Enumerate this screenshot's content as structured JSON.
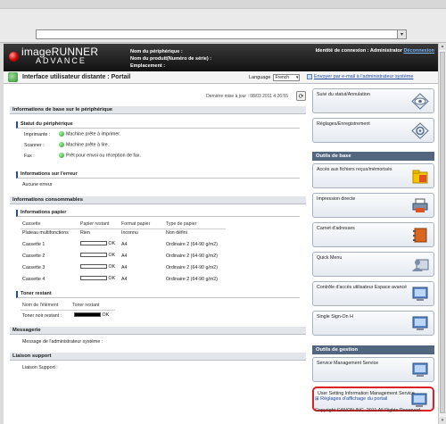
{
  "browser": {
    "address": ""
  },
  "header": {
    "logo_main": "imageRUNNER",
    "logo_sub": "ADVANCE",
    "device_name_label": "Nom du périphérique :",
    "product_name_label": "Nom du produit(Numéro de série) :",
    "location_label": "Emplacement :",
    "login_text": "Identité de connexion : Administrator",
    "logout_link": "Déconnexion"
  },
  "titlebar": {
    "title": "Interface utilisateur distante : Portail",
    "language_label": "Language",
    "language_value": "French",
    "email_link": "Envoyer par e-mail à l'administrateur système"
  },
  "main": {
    "last_update": "Dernière mise à jour : 08/03 2011 4:26:55",
    "basic_info_header": "Informations de base sur le périphérique",
    "device_status_header": "Statut du périphérique",
    "status_rows": [
      {
        "label": "Imprimante :",
        "value": "Machine prête à imprimer."
      },
      {
        "label": "Scanner :",
        "value": "Machine prête à lire."
      },
      {
        "label": "Fax :",
        "value": "Prêt pour envoi ou réception de fax."
      }
    ],
    "error_header": "Informations sur l'erreur",
    "error_value": "Aucune erreur",
    "consumables_header": "Informations consommables",
    "paper_header": "Informations papier",
    "paper_columns": [
      "Cassette",
      "Papier restant",
      "Format papier",
      "Type de papier"
    ],
    "paper_rows": [
      {
        "name": "Plateau multifonctions",
        "remaining": "Rien",
        "format": "Inconnu",
        "type": "Non défini"
      },
      {
        "name": "Cassette 1",
        "remaining": "OK",
        "format": "A4",
        "type": "Ordinaire 2 (64-90 g/m2)"
      },
      {
        "name": "Cassette 2",
        "remaining": "OK",
        "format": "A4",
        "type": "Ordinaire 2 (64-90 g/m2)"
      },
      {
        "name": "Cassette 3",
        "remaining": "OK",
        "format": "A4",
        "type": "Ordinaire 2 (64-90 g/m2)"
      },
      {
        "name": "Cassette 4",
        "remaining": "OK",
        "format": "A4",
        "type": "Ordinaire 2 (64-90 g/m2)"
      }
    ],
    "toner_header": "Toner restant",
    "toner_columns": [
      "Nom de l'élément",
      "Toner restant"
    ],
    "toner_label": "Toner noir restant :",
    "toner_value": "OK",
    "messages_header": "Messagerie",
    "admin_message_label": "Message de l'administrateur système :",
    "support_header": "Liaison support",
    "support_label": "Liaison Support :"
  },
  "right_panel": {
    "cards_top": [
      {
        "label": "Suivi du statut/Annulation",
        "icon": "eye-icon"
      },
      {
        "label": "Réglages/Enregistrement",
        "icon": "gear-icon"
      }
    ],
    "tools_header": "Outils de base",
    "tools": [
      {
        "label": "Accès aux fichiers reçus/mémorisés",
        "icon": "folder-icon"
      },
      {
        "label": "Impression directe",
        "icon": "printer-icon"
      },
      {
        "label": "Carnet d'adresses",
        "icon": "address-book-icon"
      },
      {
        "label": "Quick Menu",
        "icon": "user-menu-icon"
      },
      {
        "label": "Contrôle d'accès utilisateur Espace avancé",
        "icon": "monitor-icon"
      },
      {
        "label": "Single Sign-On H",
        "icon": "monitor-icon"
      }
    ],
    "management_header": "Outils de gestion",
    "management": [
      {
        "label": "Service Management Service",
        "icon": "monitor-icon"
      },
      {
        "label": "User Setting Information Management Service",
        "icon": "monitor-icon"
      }
    ],
    "portal_settings_link": "Réglages d'affichage du portail"
  },
  "footer": {
    "copyright": "Copyright CANON INC. 2011 All Rights Reserved"
  }
}
